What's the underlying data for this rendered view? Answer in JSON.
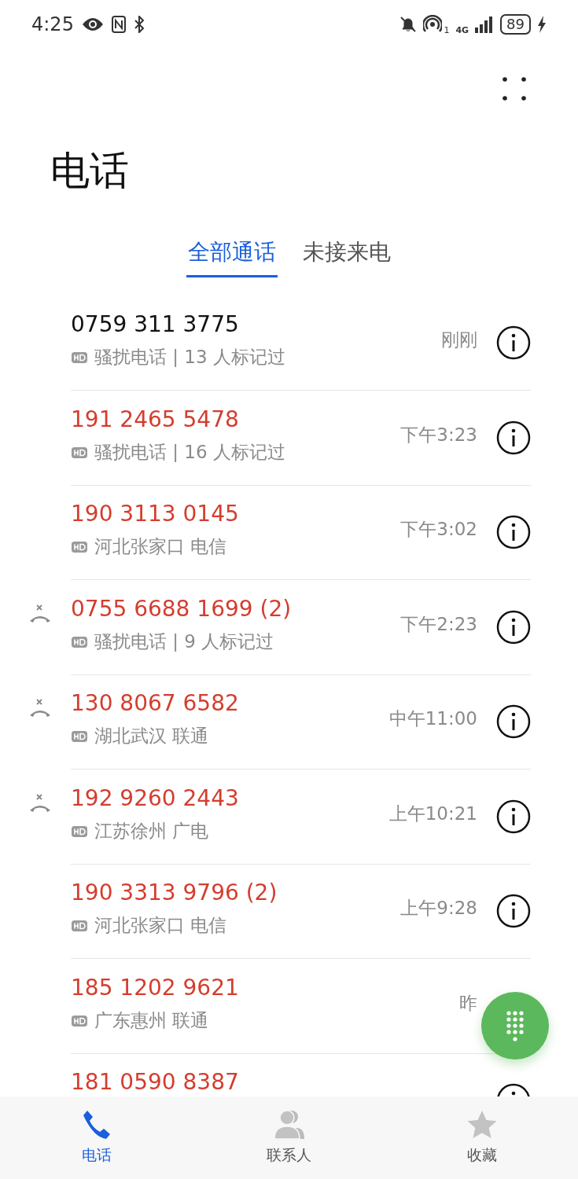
{
  "status_bar": {
    "time": "4:25",
    "sim": "1",
    "network": "4G",
    "battery": "89"
  },
  "title": "电话",
  "tabs": [
    {
      "label": "全部通话",
      "selected": true
    },
    {
      "label": "未接来电",
      "selected": false
    }
  ],
  "calls": [
    {
      "number": "0759 311 3775",
      "detail": "骚扰电话 | 13 人标记过",
      "time": "刚刚",
      "missed": false,
      "rejected": false
    },
    {
      "number": "191 2465 5478",
      "detail": "骚扰电话 | 16 人标记过",
      "time": "下午3:23",
      "missed": true,
      "rejected": false
    },
    {
      "number": "190 3113 0145",
      "detail": "河北张家口 电信",
      "time": "下午3:02",
      "missed": true,
      "rejected": false
    },
    {
      "number": "0755 6688 1699 (2)",
      "detail": "骚扰电话 | 9 人标记过",
      "time": "下午2:23",
      "missed": true,
      "rejected": true
    },
    {
      "number": "130 8067 6582",
      "detail": "湖北武汉 联通",
      "time": "中午11:00",
      "missed": true,
      "rejected": true
    },
    {
      "number": "192 9260 2443",
      "detail": "江苏徐州 广电",
      "time": "上午10:21",
      "missed": true,
      "rejected": true
    },
    {
      "number": "190 3313 9796 (2)",
      "detail": "河北张家口 电信",
      "time": "上午9:28",
      "missed": true,
      "rejected": false
    },
    {
      "number": "185 1202 9621",
      "detail": "广东惠州 联通",
      "time": "昨",
      "missed": true,
      "rejected": false
    },
    {
      "number": "181 0590 8387",
      "missed": true,
      "rejected": false
    }
  ],
  "bottom_nav": [
    {
      "label": "电话",
      "selected": true,
      "kind": "phone"
    },
    {
      "label": "联系人",
      "selected": false,
      "kind": "contacts"
    },
    {
      "label": "收藏",
      "selected": false,
      "kind": "star"
    }
  ]
}
